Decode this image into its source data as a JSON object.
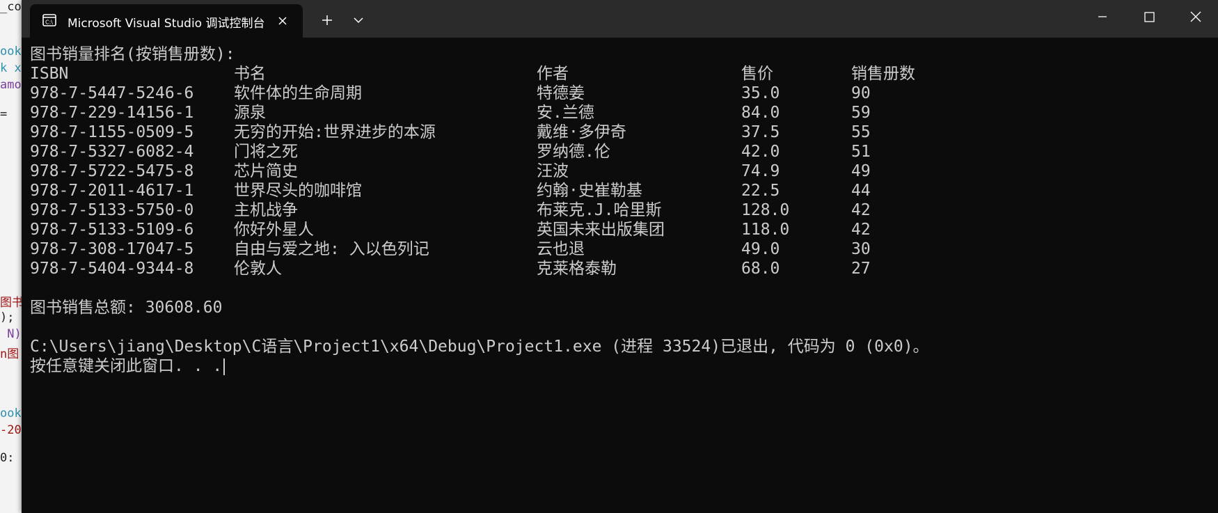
{
  "background_editor": {
    "fragments": [
      {
        "text": "_co",
        "color": "#1f1f1f"
      },
      {
        "text": "ook",
        "color": "#2b91af"
      },
      {
        "text": "k x",
        "color": "#2b91af"
      },
      {
        "text": "amo",
        "color": "#7a3e9d"
      },
      {
        "text": "=",
        "color": "#1f1f1f"
      },
      {
        "text": "图书",
        "color": "#a31515"
      },
      {
        "text": ");",
        "color": "#1f1f1f"
      },
      {
        "text": " N)",
        "color": "#7a3e9d"
      },
      {
        "text": "n图",
        "color": "#a31515"
      },
      {
        "text": "ook",
        "color": "#2b91af"
      },
      {
        "text": "-20",
        "color": "#a31515"
      },
      {
        "text": "0:",
        "color": "#1f1f1f"
      }
    ]
  },
  "window": {
    "tab_title": "Microsoft Visual Studio 调试控制台",
    "colors": {
      "titlebar": "#2b2b2b",
      "console_bg": "#0c0c0c",
      "console_text": "#cccccc"
    }
  },
  "console": {
    "heading": "图书销量排名(按销售册数):",
    "headers": {
      "isbn": "ISBN",
      "title": "书名",
      "author": "作者",
      "price": "售价",
      "sold": "销售册数"
    },
    "rows": [
      {
        "isbn": "978-7-5447-5246-6",
        "title": "软件体的生命周期",
        "author": "特德姜",
        "price": "35.0",
        "sold": "90"
      },
      {
        "isbn": "978-7-229-14156-1",
        "title": "源泉",
        "author": "安.兰德",
        "price": "84.0",
        "sold": "59"
      },
      {
        "isbn": "978-7-1155-0509-5",
        "title": "无穷的开始:世界进步的本源",
        "author": "戴维·多伊奇",
        "price": "37.5",
        "sold": "55"
      },
      {
        "isbn": "978-7-5327-6082-4",
        "title": "门将之死",
        "author": "罗纳德.伦",
        "price": "42.0",
        "sold": "51"
      },
      {
        "isbn": "978-7-5722-5475-8",
        "title": "芯片简史",
        "author": "汪波",
        "price": "74.9",
        "sold": "49"
      },
      {
        "isbn": "978-7-2011-4617-1",
        "title": "世界尽头的咖啡馆",
        "author": "约翰·史崔勒基",
        "price": "22.5",
        "sold": "44"
      },
      {
        "isbn": "978-7-5133-5750-0",
        "title": "主机战争",
        "author": "布莱克.J.哈里斯",
        "price": "128.0",
        "sold": "42"
      },
      {
        "isbn": "978-7-5133-5109-6",
        "title": "你好外星人",
        "author": "英国未来出版集团",
        "price": "118.0",
        "sold": "42"
      },
      {
        "isbn": "978-7-308-17047-5",
        "title": "自由与爱之地: 入以色列记",
        "author": "云也退",
        "price": "49.0",
        "sold": "30"
      },
      {
        "isbn": "978-7-5404-9344-8",
        "title": "伦敦人",
        "author": "克莱格泰勒",
        "price": "68.0",
        "sold": "27"
      }
    ],
    "total_line": "图书销售总额: 30608.60",
    "exit_line": "C:\\Users\\jiang\\Desktop\\C语言\\Project1\\x64\\Debug\\Project1.exe (进程 33524)已退出, 代码为 0 (0x0)。",
    "prompt_line": "按任意键关闭此窗口. . ."
  }
}
